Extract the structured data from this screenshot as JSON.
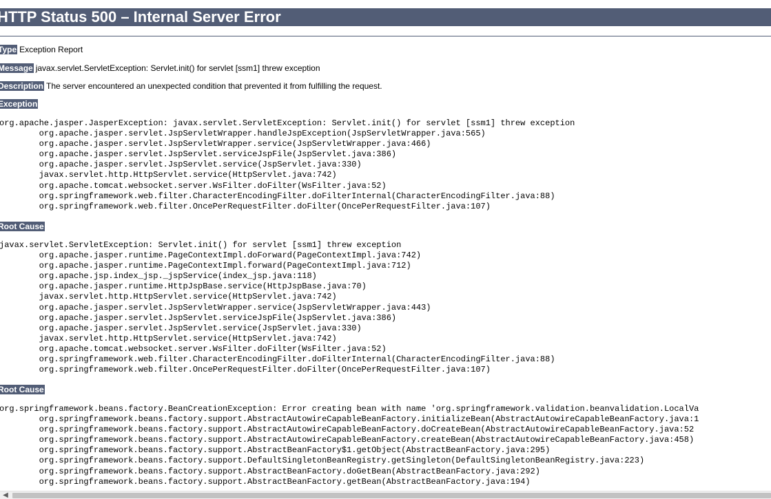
{
  "page": {
    "title": "HTTP Status 500 – Internal Server Error"
  },
  "summary": {
    "type_label": "Type",
    "type_value": "Exception Report",
    "message_label": "Message",
    "message_value": "javax.servlet.ServletException: Servlet.init() for servlet [ssm1] threw exception",
    "description_label": "Description",
    "description_value": "The server encountered an unexpected condition that prevented it from fulfilling the request."
  },
  "exception": {
    "label": "Exception",
    "trace": "org.apache.jasper.JasperException: javax.servlet.ServletException: Servlet.init() for servlet [ssm1] threw exception\n\torg.apache.jasper.servlet.JspServletWrapper.handleJspException(JspServletWrapper.java:565)\n\torg.apache.jasper.servlet.JspServletWrapper.service(JspServletWrapper.java:466)\n\torg.apache.jasper.servlet.JspServlet.serviceJspFile(JspServlet.java:386)\n\torg.apache.jasper.servlet.JspServlet.service(JspServlet.java:330)\n\tjavax.servlet.http.HttpServlet.service(HttpServlet.java:742)\n\torg.apache.tomcat.websocket.server.WsFilter.doFilter(WsFilter.java:52)\n\torg.springframework.web.filter.CharacterEncodingFilter.doFilterInternal(CharacterEncodingFilter.java:88)\n\torg.springframework.web.filter.OncePerRequestFilter.doFilter(OncePerRequestFilter.java:107)"
  },
  "root_cause_1": {
    "label": "Root Cause",
    "trace": "javax.servlet.ServletException: Servlet.init() for servlet [ssm1] threw exception\n\torg.apache.jasper.runtime.PageContextImpl.doForward(PageContextImpl.java:742)\n\torg.apache.jasper.runtime.PageContextImpl.forward(PageContextImpl.java:712)\n\torg.apache.jsp.index_jsp._jspService(index_jsp.java:118)\n\torg.apache.jasper.runtime.HttpJspBase.service(HttpJspBase.java:70)\n\tjavax.servlet.http.HttpServlet.service(HttpServlet.java:742)\n\torg.apache.jasper.servlet.JspServletWrapper.service(JspServletWrapper.java:443)\n\torg.apache.jasper.servlet.JspServlet.serviceJspFile(JspServlet.java:386)\n\torg.apache.jasper.servlet.JspServlet.service(JspServlet.java:330)\n\tjavax.servlet.http.HttpServlet.service(HttpServlet.java:742)\n\torg.apache.tomcat.websocket.server.WsFilter.doFilter(WsFilter.java:52)\n\torg.springframework.web.filter.CharacterEncodingFilter.doFilterInternal(CharacterEncodingFilter.java:88)\n\torg.springframework.web.filter.OncePerRequestFilter.doFilter(OncePerRequestFilter.java:107)"
  },
  "root_cause_2": {
    "label": "Root Cause",
    "trace": "org.springframework.beans.factory.BeanCreationException: Error creating bean with name 'org.springframework.validation.beanvalidation.LocalVa\n\torg.springframework.beans.factory.support.AbstractAutowireCapableBeanFactory.initializeBean(AbstractAutowireCapableBeanFactory.java:1\n\torg.springframework.beans.factory.support.AbstractAutowireCapableBeanFactory.doCreateBean(AbstractAutowireCapableBeanFactory.java:52\n\torg.springframework.beans.factory.support.AbstractAutowireCapableBeanFactory.createBean(AbstractAutowireCapableBeanFactory.java:458)\n\torg.springframework.beans.factory.support.AbstractBeanFactory$1.getObject(AbstractBeanFactory.java:295)\n\torg.springframework.beans.factory.support.DefaultSingletonBeanRegistry.getSingleton(DefaultSingletonBeanRegistry.java:223)\n\torg.springframework.beans.factory.support.AbstractBeanFactory.doGetBean(AbstractBeanFactory.java:292)\n\torg.springframework.beans.factory.support.AbstractBeanFactory.getBean(AbstractBeanFactory.java:194)"
  },
  "colors": {
    "heading_background": "#525D76",
    "heading_text": "#FFFFFF",
    "page_background": "#FFFFFF"
  },
  "scrollbar": {
    "left_arrow_icon": "chevron-left-icon"
  }
}
